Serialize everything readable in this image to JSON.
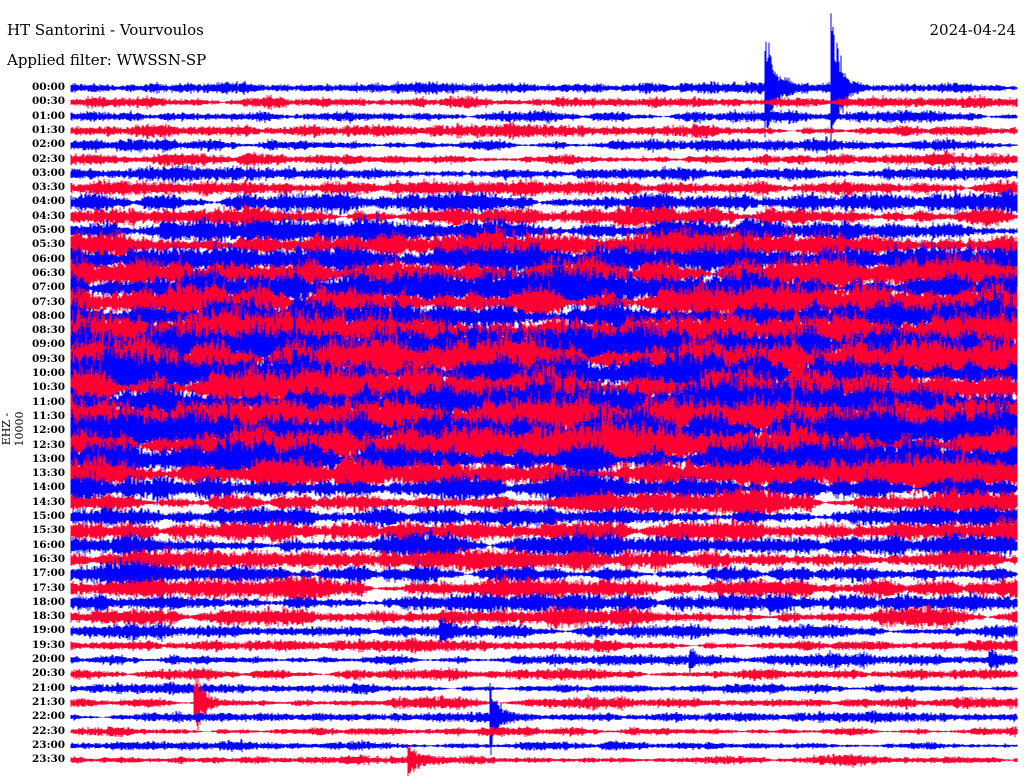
{
  "header": {
    "station": "HT Santorini - Vourvoulos",
    "filter": "Applied filter: WWSSN-SP",
    "date": "2024-04-24",
    "channel": "EHZ - 10000"
  },
  "chart_data": {
    "type": "line",
    "title": "HT Santorini - Vourvoulos",
    "ylabel": "EHZ - 10000",
    "xlabel": "",
    "x_range_minutes": [
      0,
      30
    ],
    "colors": [
      "#0000ff",
      "#ff0033"
    ],
    "rows": [
      "00:00",
      "00:30",
      "01:00",
      "01:30",
      "02:00",
      "02:30",
      "03:00",
      "03:30",
      "04:00",
      "04:30",
      "05:00",
      "05:30",
      "06:00",
      "06:30",
      "07:00",
      "07:30",
      "08:00",
      "08:30",
      "09:00",
      "09:30",
      "10:00",
      "10:30",
      "11:00",
      "11:30",
      "12:00",
      "12:30",
      "13:00",
      "13:30",
      "14:00",
      "14:30",
      "15:00",
      "15:30",
      "16:00",
      "16:30",
      "17:00",
      "17:30",
      "18:00",
      "18:30",
      "19:00",
      "19:30",
      "20:00",
      "20:30",
      "21:00",
      "21:30",
      "22:00",
      "22:30",
      "23:00",
      "23:30"
    ],
    "noise_level": [
      2.2,
      2.4,
      2.3,
      2.6,
      2.5,
      2.7,
      2.9,
      3.4,
      4,
      4.6,
      5.5,
      6.5,
      7,
      7.5,
      8,
      8.5,
      9,
      9.5,
      10,
      10,
      10,
      10,
      10,
      10,
      10,
      9.5,
      9,
      8,
      6,
      5,
      4.5,
      4.5,
      4.5,
      4.5,
      4.5,
      4.2,
      4,
      3.4,
      2.6,
      2.4,
      2.3,
      2.2,
      2,
      2,
      2,
      1.9,
      1.9,
      1.8
    ],
    "events": [
      {
        "row": "00:00",
        "minute": 22.0,
        "amplitude": 60
      },
      {
        "row": "00:00",
        "minute": 24.1,
        "amplitude": 72
      },
      {
        "row": "13:30",
        "minute": 19.5,
        "amplitude": 14
      },
      {
        "row": "19:00",
        "minute": 11.7,
        "amplitude": 10
      },
      {
        "row": "20:00",
        "minute": 19.6,
        "amplitude": 9
      },
      {
        "row": "20:00",
        "minute": 29.1,
        "amplitude": 10
      },
      {
        "row": "21:30",
        "minute": 3.9,
        "amplitude": 40
      },
      {
        "row": "22:00",
        "minute": 13.3,
        "amplitude": 30
      },
      {
        "row": "23:30",
        "minute": 10.7,
        "amplitude": 16
      }
    ]
  }
}
